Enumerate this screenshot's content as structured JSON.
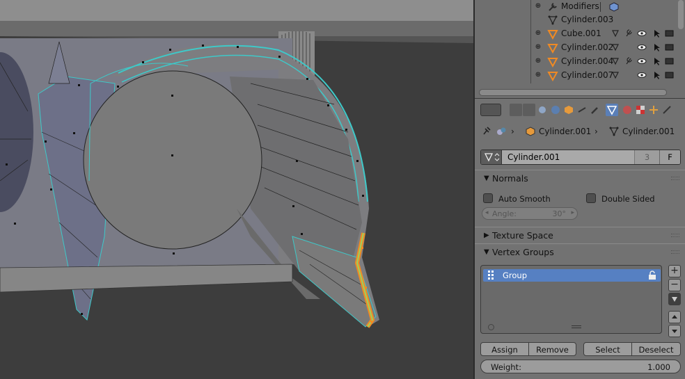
{
  "outliner": {
    "rows": [
      {
        "label": "Modifiers",
        "icon": "wrench-icon",
        "expand": "⊕"
      },
      {
        "label": "Cylinder.003",
        "icon": "mesh-data-icon",
        "expand": ""
      },
      {
        "label": "Cube.001",
        "icon": "object-mesh-icon",
        "expand": "⊕"
      },
      {
        "label": "Cylinder.002",
        "icon": "object-mesh-icon",
        "expand": "⊕"
      },
      {
        "label": "Cylinder.004",
        "icon": "object-mesh-icon",
        "expand": "⊕"
      },
      {
        "label": "Cylinder.007",
        "icon": "object-mesh-icon",
        "expand": "⊕"
      }
    ]
  },
  "breadcrumb": {
    "object": "Cylinder.001",
    "mesh": "Cylinder.001",
    "separator": "›"
  },
  "mesh_datablock": {
    "name": "Cylinder.001",
    "users": "3",
    "fake_user": "F"
  },
  "normals": {
    "title": "Normals",
    "auto_smooth": "Auto Smooth",
    "double_sided": "Double Sided",
    "angle_label": "Angle:",
    "angle_value": "30°"
  },
  "texture_space": {
    "title": "Texture Space"
  },
  "vertex_groups": {
    "title": "Vertex Groups",
    "items": [
      {
        "name": "Group"
      }
    ],
    "add": "+",
    "remove": "−"
  },
  "buttons": {
    "assign": "Assign",
    "remove": "Remove",
    "select": "Select",
    "deselect": "Deselect"
  },
  "weight": {
    "label": "Weight:",
    "value": "1.000"
  },
  "colors": {
    "selection_edge": "#3ec9c9",
    "selected_group": "#5680c2",
    "active_tab": "#5a7fb8",
    "highlight_orange": "#f08a24"
  }
}
